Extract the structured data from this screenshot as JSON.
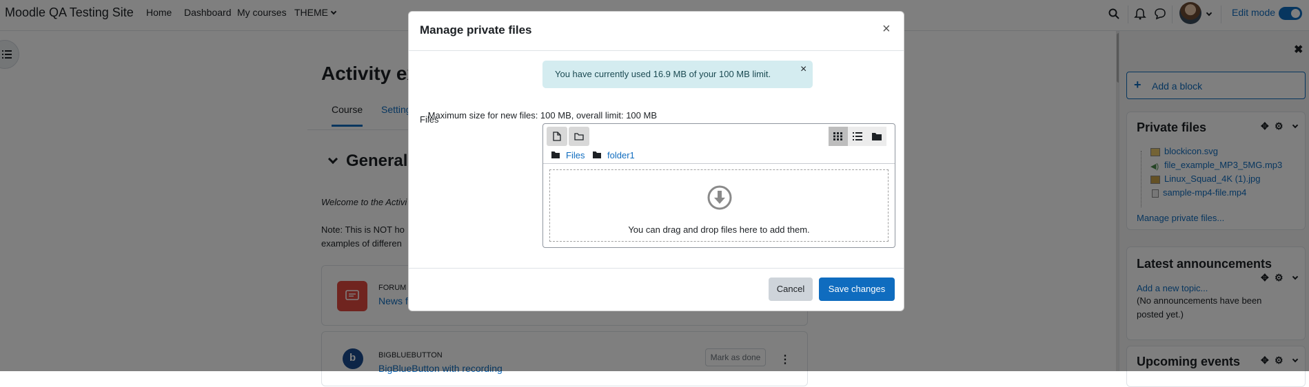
{
  "navbar": {
    "brand": "Moodle QA Testing Site",
    "items": [
      "Home",
      "Dashboard",
      "My courses",
      "THEME"
    ],
    "edit_mode_label": "Edit mode",
    "icons": [
      "search-icon",
      "bell-icon",
      "chat-icon",
      "avatar",
      "chevron-down-icon"
    ]
  },
  "course": {
    "title": "Activity ex",
    "tabs": [
      "Course",
      "Setting"
    ],
    "section_title": "General",
    "welcome": "Welcome to the Activi",
    "note_line1": "Note: This is NOT ho",
    "note_line2": "examples of differen",
    "activities": [
      {
        "type": "Forum",
        "name": "News fo",
        "icon_color": "#e0483e"
      },
      {
        "type": "BigBlueButton",
        "name": "BigBlueButton with recording",
        "mark_done": "Mark as done",
        "icon_color": "#1a4b8e"
      }
    ]
  },
  "drawer": {
    "add_block": "Add a block",
    "private_files": {
      "title": "Private files",
      "files": [
        "blockicon.svg",
        "file_example_MP3_5MG.mp3",
        "Linux_Squad_4K (1).jpg",
        "sample-mp4-file.mp4"
      ],
      "manage_link": "Manage private files..."
    },
    "announcements": {
      "title": "Latest announcements",
      "add_link": "Add a new topic...",
      "empty_text": "(No announcements have been posted yet.)"
    },
    "upcoming": {
      "title": "Upcoming events"
    }
  },
  "modal": {
    "title": "Manage private files",
    "close": "×",
    "alert": "You have currently used 16.9 MB of your 100 MB limit.",
    "alert_close": "×",
    "files_label": "Files",
    "max_size": "Maximum size for new files: 100 MB, overall limit: 100 MB",
    "breadcrumb": [
      "Files",
      "folder1"
    ],
    "drop_text": "You can drag and drop files here to add them.",
    "cancel": "Cancel",
    "save": "Save changes"
  },
  "colors": {
    "primary": "#0f6cbf",
    "alert_bg": "#d4ecf0",
    "backdrop": "rgba(0,0,0,0.5)"
  }
}
